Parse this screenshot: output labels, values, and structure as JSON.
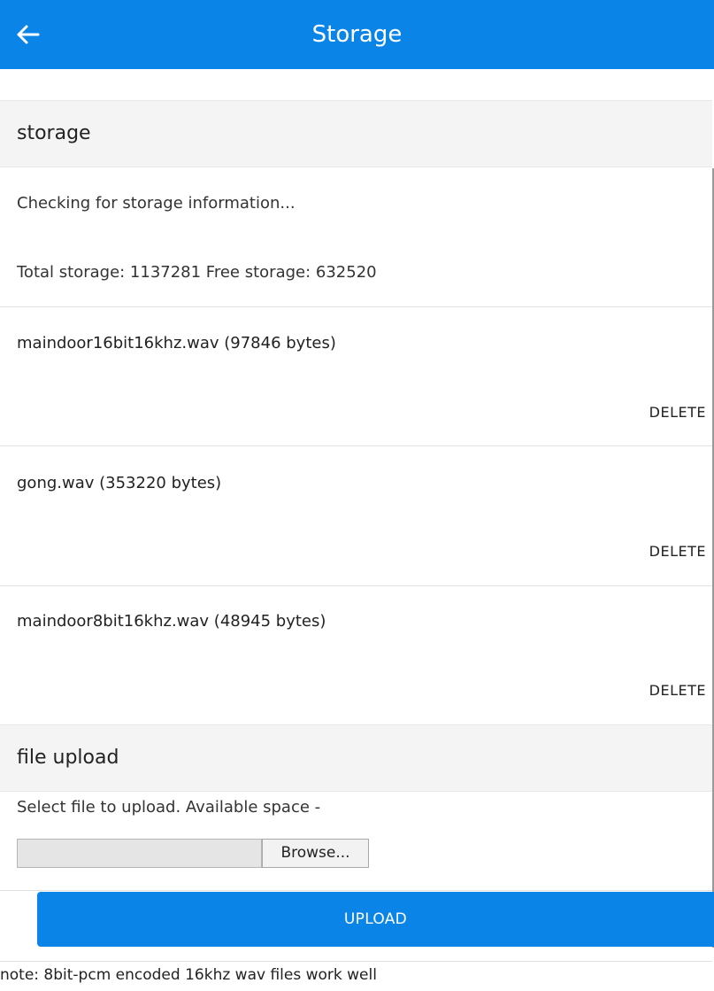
{
  "appbar": {
    "title": "Storage",
    "back_icon": "arrow-left-icon"
  },
  "storage_section": {
    "header": "storage",
    "status": "Checking for storage information...",
    "summary": "Total storage: 1137281 Free storage: 632520"
  },
  "files": [
    {
      "name": "maindoor16bit16khz.wav (97846 bytes)",
      "delete_label": "DELETE"
    },
    {
      "name": "gong.wav (353220 bytes)",
      "delete_label": "DELETE"
    },
    {
      "name": "maindoor8bit16khz.wav (48945 bytes)",
      "delete_label": "DELETE"
    }
  ],
  "upload_section": {
    "header": "file upload",
    "instruction": "Select file to upload. Available space -",
    "browse_label": "Browse...",
    "upload_label": "UPLOAD",
    "note": "note: 8bit-pcm encoded 16khz wav files work well"
  },
  "colors": {
    "accent": "#0a84e6",
    "section_bg": "#f4f4f4"
  }
}
